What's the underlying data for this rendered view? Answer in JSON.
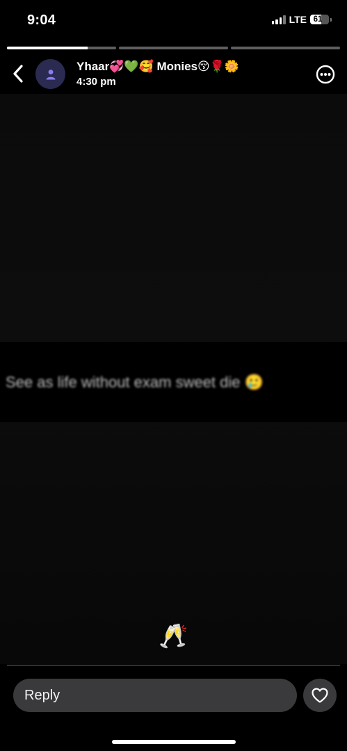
{
  "status_bar": {
    "time": "9:04",
    "network": "LTE",
    "battery_level": "61",
    "battery_fraction": 0.61,
    "signal_bars_active": 3,
    "signal_bars_total": 4
  },
  "story": {
    "segments": [
      {
        "progress": 0.74
      },
      {
        "progress": 0
      },
      {
        "progress": 0
      }
    ]
  },
  "header": {
    "contact_name": "Yhaar💞💚🥰 Monies😚🌹🌼",
    "post_time": "4:30 pm",
    "icons": [
      "back-chevron-icon",
      "person-icon",
      "more-options-icon"
    ]
  },
  "content": {
    "caption": "See as life without exam sweet die 🥲",
    "emoji": "🥂"
  },
  "reply": {
    "placeholder": "Reply",
    "like_icon": "heart-icon"
  },
  "colors": {
    "background": "#000000",
    "avatar_bg": "#2b2b52",
    "avatar_icon": "#8c7cf0",
    "reply_bg": "#3a3a3c"
  }
}
